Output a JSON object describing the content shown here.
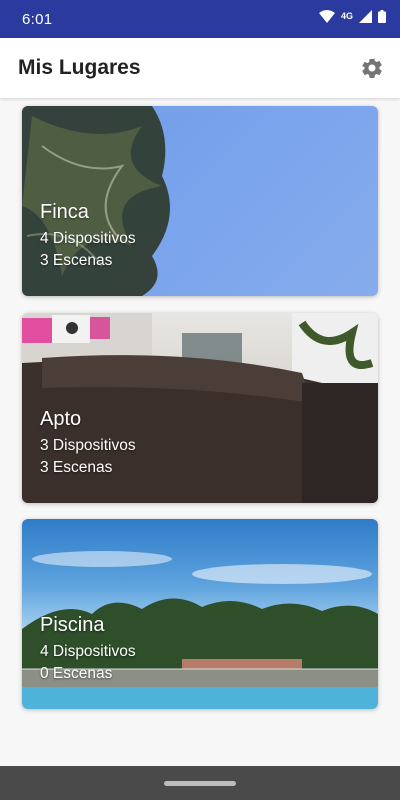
{
  "status_bar": {
    "time": "6:01",
    "network": "4G"
  },
  "app_bar": {
    "title": "Mis Lugares",
    "settings_icon": "gear-icon"
  },
  "places": [
    {
      "name": "Finca",
      "devices": "4 Dispositivos",
      "scenes": "3 Escenas"
    },
    {
      "name": "Apto",
      "devices": "3 Dispositivos",
      "scenes": "3 Escenas"
    },
    {
      "name": "Piscina",
      "devices": "4 Dispositivos",
      "scenes": "0 Escenas"
    }
  ],
  "colors": {
    "status_bar": "#2b3a9e",
    "app_bar": "#ffffff",
    "background": "#f7f7f7",
    "nav_bar": "#4a4a4a"
  }
}
